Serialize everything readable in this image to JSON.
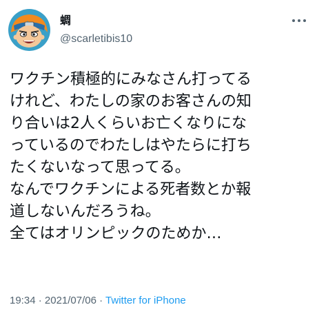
{
  "author": {
    "display_name": "蜩",
    "handle": "@scarletibis10"
  },
  "tweet": {
    "lines": [
      "ワクチン積極的にみなさん打ってる",
      "けれど、わたしの家のお客さんの知",
      "り合いは2人くらいお亡くなりにな",
      "っているのでわたしはやたらに打ち",
      "たくないなって思ってる。",
      "なんでワクチンによる死者数とか報",
      "道しないんだろうね。",
      "全てはオリンピックのためか…"
    ]
  },
  "meta": {
    "time": "19:34",
    "separator_1": " · ",
    "date": "2021/07/06",
    "separator_2": " · ",
    "source": "Twitter for iPhone"
  },
  "icons": {
    "more": "more-dots-icon",
    "avatar": "anime-character-avatar"
  },
  "colors": {
    "text": "#0f1419",
    "secondary": "#536471",
    "link": "#1d9bf0"
  }
}
